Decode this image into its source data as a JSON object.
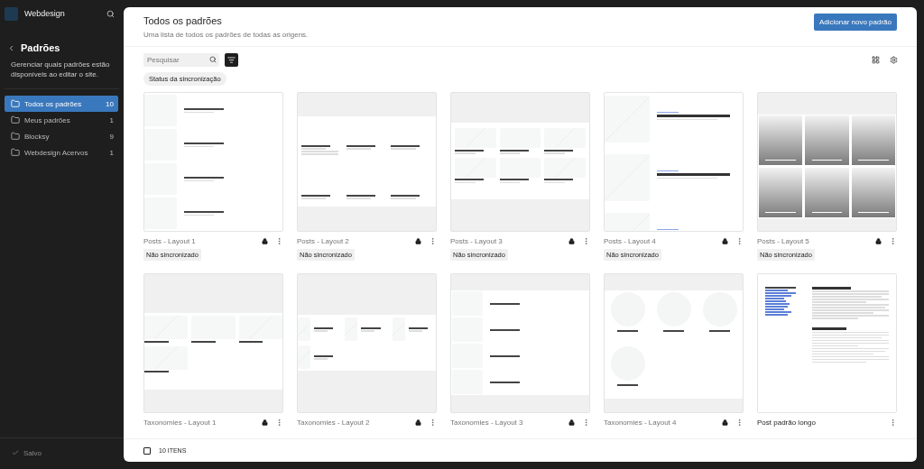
{
  "sidebar": {
    "site_title": "Webdesign",
    "heading": "Padrões",
    "description": "Gerenciar quais padrões estão disponíveis ao editar o site.",
    "items": [
      {
        "label": "Todos os padrões",
        "count": "10",
        "selected": true
      },
      {
        "label": "Meus padrões",
        "count": "1",
        "selected": false
      },
      {
        "label": "Blocksy",
        "count": "9",
        "selected": false
      },
      {
        "label": "Webdesign Acervos",
        "count": "1",
        "selected": false
      }
    ],
    "status": "Salvo"
  },
  "header": {
    "title": "Todos os padrões",
    "subtitle": "Uma lista de todos os padrões de todas as origens.",
    "button": "Adicionar novo padrão"
  },
  "toolbar": {
    "search": {
      "placeholder": "Pesquisar"
    },
    "filter_chip": "Status da sincronização"
  },
  "patterns": [
    {
      "title": "Posts - Layout 1",
      "locked": true,
      "badge": "Não sincronizado",
      "preview": {
        "kind": "list"
      }
    },
    {
      "title": "Posts - Layout 2",
      "locked": true,
      "badge": "Não sincronizado",
      "preview": {
        "kind": "grid"
      }
    },
    {
      "title": "Posts - Layout 3",
      "locked": true,
      "badge": "Não sincronizado",
      "preview": {
        "kind": "cards"
      }
    },
    {
      "title": "Posts - Layout 4",
      "locked": true,
      "badge": "Não sincronizado",
      "preview": {
        "kind": "feature"
      }
    },
    {
      "title": "Posts - Layout 5",
      "locked": true,
      "badge": "Não sincronizado",
      "preview": {
        "kind": "overlay"
      }
    },
    {
      "title": "Taxonomies - Layout 1",
      "locked": true,
      "preview": {
        "kind": "tax-grid"
      }
    },
    {
      "title": "Taxonomies - Layout 2",
      "locked": true,
      "preview": {
        "kind": "tax-icons"
      }
    },
    {
      "title": "Taxonomies - Layout 3",
      "locked": true,
      "preview": {
        "kind": "tax-list"
      }
    },
    {
      "title": "Taxonomies - Layout 4",
      "locked": true,
      "preview": {
        "kind": "tax-circles"
      }
    },
    {
      "title": "Post padrão longo",
      "locked": false,
      "preview": {
        "kind": "article"
      }
    }
  ],
  "footer": {
    "count": "10 ITENS",
    "checked": false
  }
}
